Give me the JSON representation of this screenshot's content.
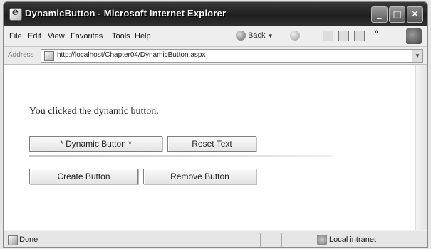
{
  "window": {
    "title": "DynamicButton - Microsoft Internet Explorer",
    "controls": {
      "minimize": "_",
      "maximize": "□",
      "close": "✕"
    }
  },
  "menu": {
    "items": [
      "File",
      "Edit",
      "View",
      "Favorites",
      "Tools",
      "Help"
    ]
  },
  "toolbar": {
    "back_label": "Back",
    "chevron": "»"
  },
  "address": {
    "label": "Address",
    "url": "http://localhost/Chapter04/DynamicButton.aspx"
  },
  "page": {
    "message": "You clicked the dynamic button.",
    "buttons": {
      "dynamic": "* Dynamic Button *",
      "reset": "Reset Text",
      "create": "Create Button",
      "remove": "Remove Button"
    }
  },
  "status": {
    "text": "Done",
    "zone": "Local intranet"
  }
}
